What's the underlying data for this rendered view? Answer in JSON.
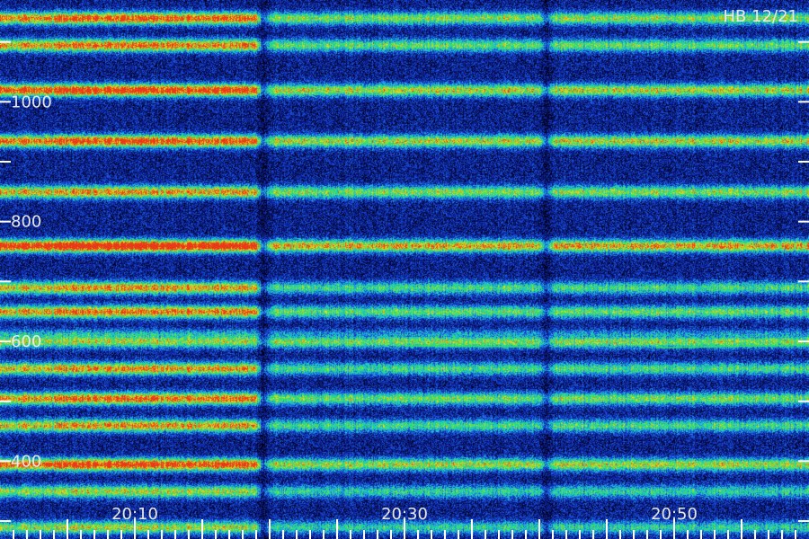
{
  "annotation": "HB 12/21",
  "chart_data": {
    "type": "heatmap",
    "title": "",
    "xlabel": "",
    "ylabel": "",
    "x_ticks": [
      "20:10",
      "20:30",
      "20:50"
    ],
    "x_tick_minutes": [
      10,
      30,
      50
    ],
    "x_range_minutes": [
      0,
      60
    ],
    "y_ticks": [
      400,
      600,
      800,
      1000
    ],
    "y_range": [
      270,
      1170
    ],
    "colormap": [
      "#000010",
      "#0a1a8a",
      "#1a4fe0",
      "#1ec8d8",
      "#2ee060",
      "#e8e020",
      "#e83a18"
    ],
    "emission_bands_hz": [
      {
        "center": 1140,
        "level": 0.55,
        "early_boost": 0.3
      },
      {
        "center": 1095,
        "level": 0.5,
        "early_boost": 0.3
      },
      {
        "center": 1020,
        "level": 0.62,
        "early_boost": 0.3
      },
      {
        "center": 935,
        "level": 0.62,
        "early_boost": 0.25
      },
      {
        "center": 850,
        "level": 0.55,
        "early_boost": 0.2
      },
      {
        "center": 760,
        "level": 0.72,
        "early_boost": 0.3
      },
      {
        "center": 690,
        "level": 0.45,
        "early_boost": 0.3
      },
      {
        "center": 650,
        "level": 0.5,
        "early_boost": 0.3
      },
      {
        "center": 610,
        "level": 0.3,
        "early_boost": 0.1
      },
      {
        "center": 600,
        "level": 0.55,
        "early_boost": 0.0
      },
      {
        "center": 555,
        "level": 0.45,
        "early_boost": 0.3
      },
      {
        "center": 505,
        "level": 0.52,
        "early_boost": 0.3
      },
      {
        "center": 460,
        "level": 0.45,
        "early_boost": 0.3
      },
      {
        "center": 395,
        "level": 0.6,
        "early_boost": 0.3
      },
      {
        "center": 350,
        "level": 0.4,
        "early_boost": 0.2
      },
      {
        "center": 290,
        "level": 0.4,
        "early_boost": 0.2
      }
    ],
    "dropout_minutes": [
      19.5,
      40.5
    ]
  }
}
